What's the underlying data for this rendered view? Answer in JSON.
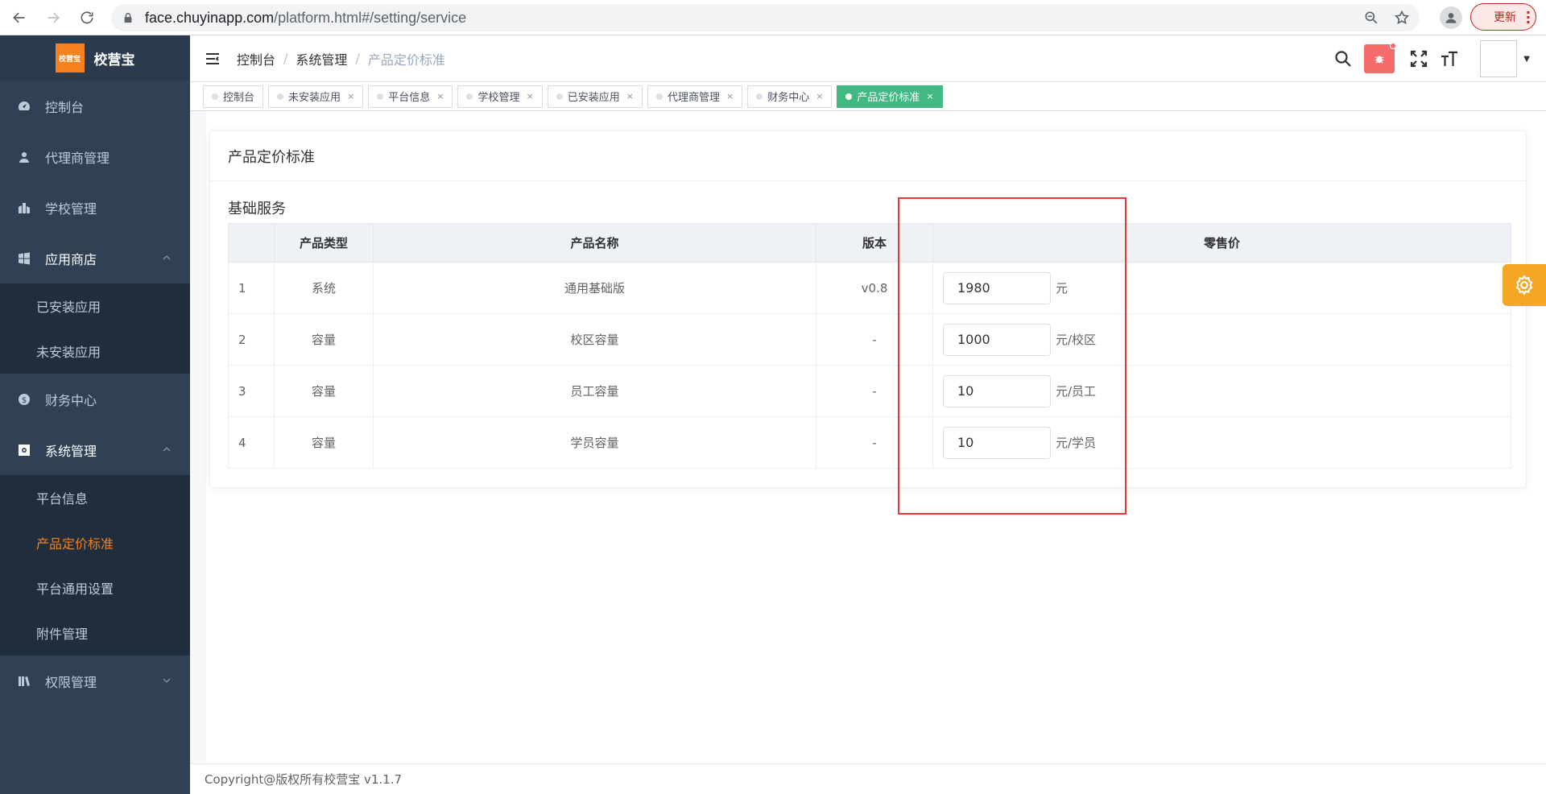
{
  "browser": {
    "url_host": "face.chuyinapp.com",
    "url_path": "/platform.html#/setting/service",
    "update_label": "更新"
  },
  "sidebar": {
    "logo_text": "校营宝",
    "logo_badge": "校营宝",
    "items": [
      {
        "label": "控制台",
        "icon": "dashboard-icon"
      },
      {
        "label": "代理商管理",
        "icon": "user-icon"
      },
      {
        "label": "学校管理",
        "icon": "building-icon"
      },
      {
        "label": "应用商店",
        "icon": "windows-icon",
        "expanded": true,
        "children": [
          {
            "label": "已安装应用"
          },
          {
            "label": "未安装应用"
          }
        ]
      },
      {
        "label": "财务中心",
        "icon": "money-icon"
      },
      {
        "label": "系统管理",
        "icon": "settings-icon",
        "expanded": true,
        "children": [
          {
            "label": "平台信息"
          },
          {
            "label": "产品定价标准",
            "active": true
          },
          {
            "label": "平台通用设置"
          },
          {
            "label": "附件管理"
          }
        ]
      },
      {
        "label": "权限管理",
        "icon": "books-icon",
        "expanded": false
      }
    ]
  },
  "breadcrumb": [
    "控制台",
    "系统管理",
    "产品定价标准"
  ],
  "tags": [
    {
      "label": "控制台",
      "closable": false,
      "active": false
    },
    {
      "label": "未安装应用",
      "closable": true,
      "active": false
    },
    {
      "label": "平台信息",
      "closable": true,
      "active": false
    },
    {
      "label": "学校管理",
      "closable": true,
      "active": false
    },
    {
      "label": "已安装应用",
      "closable": true,
      "active": false
    },
    {
      "label": "代理商管理",
      "closable": true,
      "active": false
    },
    {
      "label": "财务中心",
      "closable": true,
      "active": false
    },
    {
      "label": "产品定价标准",
      "closable": true,
      "active": true
    }
  ],
  "main": {
    "card_title": "产品定价标准",
    "section_title": "基础服务",
    "columns": [
      "",
      "产品类型",
      "产品名称",
      "版本",
      "零售价"
    ],
    "rows": [
      {
        "index": "1",
        "type": "系统",
        "name": "通用基础版",
        "version": "v0.8",
        "price": "1980",
        "unit": "元"
      },
      {
        "index": "2",
        "type": "容量",
        "name": "校区容量",
        "version": "-",
        "price": "1000",
        "unit": "元/校区"
      },
      {
        "index": "3",
        "type": "容量",
        "name": "员工容量",
        "version": "-",
        "price": "10",
        "unit": "元/员工"
      },
      {
        "index": "4",
        "type": "容量",
        "name": "学员容量",
        "version": "-",
        "price": "10",
        "unit": "元/学员"
      }
    ]
  },
  "footer": "Copyright@版权所有校营宝 v1.1.7",
  "colors": {
    "sidebar_bg": "#304156",
    "active_orange": "#f5821f",
    "tag_active": "#42b983",
    "highlight": "#e53935"
  }
}
